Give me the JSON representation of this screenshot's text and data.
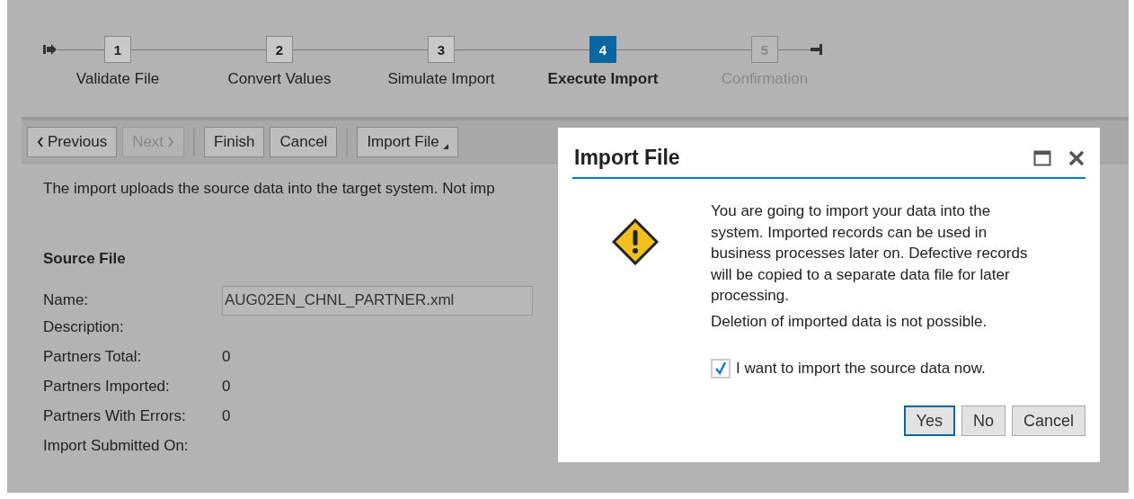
{
  "steps": [
    {
      "number": "1",
      "label": "Validate File",
      "selected": false,
      "disabled": false
    },
    {
      "number": "2",
      "label": "Convert Values",
      "selected": false,
      "disabled": false
    },
    {
      "number": "3",
      "label": "Simulate Import",
      "selected": false,
      "disabled": false
    },
    {
      "number": "4",
      "label": "Execute Import",
      "selected": true,
      "disabled": false
    },
    {
      "number": "5",
      "label": "Confirmation",
      "selected": false,
      "disabled": true
    }
  ],
  "toolbar": [
    {
      "label": "Previous",
      "kind": "back",
      "disabled": false,
      "group_start": false
    },
    {
      "label": "Next",
      "kind": "forward",
      "disabled": true,
      "group_start": false
    },
    {
      "label": "Finish",
      "kind": "plain",
      "disabled": false,
      "group_start": true
    },
    {
      "label": "Cancel",
      "kind": "plain",
      "disabled": false,
      "group_start": false
    },
    {
      "label": "Import File",
      "kind": "menu",
      "disabled": false,
      "group_start": true
    }
  ],
  "intro": "The import uploads the source data into the target system. Not imp",
  "section_title": "Source File",
  "fields": [
    {
      "label": "Name:",
      "kind": "input",
      "value": "AUG02EN_CHNL_PARTNER.xml"
    },
    {
      "label": "Description:",
      "kind": "text"
    },
    {
      "label": "Partners Total:",
      "kind": "text",
      "value": "0"
    },
    {
      "label": "Partners Imported:",
      "kind": "text",
      "value": "0"
    },
    {
      "label": "Partners With Errors:",
      "kind": "text",
      "value": "0"
    },
    {
      "label": "Import Submitted On:",
      "kind": "text"
    }
  ],
  "dialog": {
    "title": "Import File",
    "message": [
      "You are going to import your data into the system. Imported records can be used in business processes later on. Defective records will be copied to a separate data file for later processing.",
      "Deletion of imported data is not possible."
    ],
    "checkbox": {
      "label": "I want to import the source data now.",
      "checked": true
    },
    "buttons": [
      {
        "label": "Yes",
        "selected": true
      },
      {
        "label": "No",
        "selected": false
      },
      {
        "label": "Cancel",
        "selected": false
      }
    ]
  }
}
